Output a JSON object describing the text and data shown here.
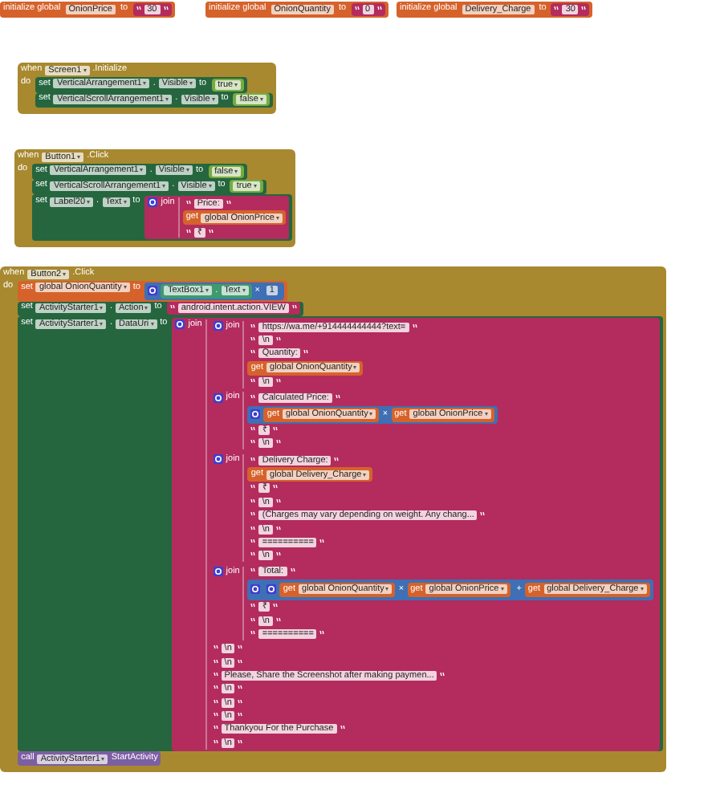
{
  "workspace": {
    "blocks": [
      {
        "kind": "init",
        "label": "initialize global",
        "name": "OnionPrice",
        "to": "to",
        "value": {
          "kind": "text",
          "value": "30"
        }
      },
      {
        "kind": "init",
        "label": "initialize global",
        "name": "OnionQuantity",
        "to": "to",
        "value": {
          "kind": "text",
          "value": "0"
        }
      },
      {
        "kind": "init",
        "label": "initialize global",
        "name": "Delivery_Charge",
        "to": "to",
        "value": {
          "kind": "text",
          "value": "30"
        }
      },
      {
        "kind": "event",
        "when": "when",
        "component": "Screen1",
        "event": ".Initialize",
        "do": "do",
        "statements": [
          {
            "kind": "set",
            "set": "set",
            "component": "VerticalArrangement1",
            "dot": ".",
            "property": "Visible",
            "to": "to",
            "value": {
              "kind": "logic",
              "value": "true"
            }
          },
          {
            "kind": "set",
            "set": "set",
            "component": "VerticalScrollArrangement1",
            "dot": ".",
            "property": "Visible",
            "to": "to",
            "value": {
              "kind": "logic",
              "value": "false"
            }
          }
        ]
      },
      {
        "kind": "event",
        "when": "when",
        "component": "Button1",
        "event": ".Click",
        "do": "do",
        "statements": [
          {
            "kind": "set",
            "set": "set",
            "component": "VerticalArrangement1",
            "dot": ".",
            "property": "Visible",
            "to": "to",
            "value": {
              "kind": "logic",
              "value": "false"
            }
          },
          {
            "kind": "set",
            "set": "set",
            "component": "VerticalScrollArrangement1",
            "dot": ".",
            "property": "Visible",
            "to": "to",
            "value": {
              "kind": "logic",
              "value": "true"
            }
          },
          {
            "kind": "set",
            "set": "set",
            "component": "Label20",
            "dot": ".",
            "property": "Text",
            "to": "to",
            "value": {
              "kind": "join",
              "label": "join",
              "items": [
                {
                  "kind": "text",
                  "value": "Price: "
                },
                {
                  "kind": "get",
                  "get": "get",
                  "variable": "global OnionPrice"
                },
                {
                  "kind": "text",
                  "value": "₹"
                }
              ]
            }
          }
        ]
      },
      {
        "kind": "event",
        "when": "when",
        "component": "Button2",
        "event": ".Click",
        "do": "do",
        "statements": [
          {
            "kind": "set_global",
            "set": "set",
            "variable": "global OnionQuantity",
            "to": "to",
            "value": {
              "kind": "math",
              "op": "×",
              "left": {
                "kind": "component_get",
                "component": "TextBox1",
                "dot": ".",
                "property": "Text"
              },
              "right": {
                "kind": "number",
                "value": "1"
              }
            }
          },
          {
            "kind": "set",
            "set": "set",
            "component": "ActivityStarter1",
            "dot": ".",
            "property": "Action",
            "to": "to",
            "value": {
              "kind": "text",
              "value": "android.intent.action.VIEW"
            }
          },
          {
            "kind": "set",
            "set": "set",
            "component": "ActivityStarter1",
            "dot": ".",
            "property": "DataUri",
            "to": "to",
            "value": {
              "kind": "join",
              "label": "join",
              "items": [
                {
                  "kind": "join",
                  "label": "join",
                  "items": [
                    {
                      "kind": "text",
                      "value": "https://wa.me/+914444444444?text="
                    },
                    {
                      "kind": "text",
                      "value": "\\n"
                    },
                    {
                      "kind": "text",
                      "value": "Quantity: "
                    },
                    {
                      "kind": "get",
                      "get": "get",
                      "variable": "global OnionQuantity"
                    },
                    {
                      "kind": "text",
                      "value": "\\n"
                    }
                  ]
                },
                {
                  "kind": "join",
                  "label": "join",
                  "items": [
                    {
                      "kind": "text",
                      "value": "Calculated Price: "
                    },
                    {
                      "kind": "math",
                      "op": "×",
                      "left": {
                        "kind": "get",
                        "get": "get",
                        "variable": "global OnionQuantity"
                      },
                      "right": {
                        "kind": "get",
                        "get": "get",
                        "variable": "global OnionPrice"
                      }
                    },
                    {
                      "kind": "text",
                      "value": "₹"
                    },
                    {
                      "kind": "text",
                      "value": "\\n"
                    }
                  ]
                },
                {
                  "kind": "join",
                  "label": "join",
                  "items": [
                    {
                      "kind": "text",
                      "value": "Delivery Charge: "
                    },
                    {
                      "kind": "get",
                      "get": "get",
                      "variable": "global Delivery_Charge"
                    },
                    {
                      "kind": "text",
                      "value": "₹"
                    },
                    {
                      "kind": "text",
                      "value": "\\n"
                    },
                    {
                      "kind": "text",
                      "value": "(Charges may vary depending on weight. Any chang..."
                    },
                    {
                      "kind": "text",
                      "value": "\\n"
                    },
                    {
                      "kind": "text",
                      "value": "=========="
                    },
                    {
                      "kind": "text",
                      "value": "\\n"
                    }
                  ]
                },
                {
                  "kind": "join",
                  "label": "join",
                  "items": [
                    {
                      "kind": "text",
                      "value": "Total: "
                    },
                    {
                      "kind": "math",
                      "op": "+",
                      "left": {
                        "kind": "math",
                        "op": "×",
                        "left": {
                          "kind": "get",
                          "get": "get",
                          "variable": "global OnionQuantity"
                        },
                        "right": {
                          "kind": "get",
                          "get": "get",
                          "variable": "global OnionPrice"
                        }
                      },
                      "right": {
                        "kind": "get",
                        "get": "get",
                        "variable": "global Delivery_Charge"
                      }
                    },
                    {
                      "kind": "text",
                      "value": "₹"
                    },
                    {
                      "kind": "text",
                      "value": "\\n"
                    },
                    {
                      "kind": "text",
                      "value": "=========="
                    }
                  ]
                },
                {
                  "kind": "text",
                  "value": "\\n"
                },
                {
                  "kind": "text",
                  "value": "\\n"
                },
                {
                  "kind": "text",
                  "value": "Please, Share the Screenshot after making paymen..."
                },
                {
                  "kind": "text",
                  "value": "\\n"
                },
                {
                  "kind": "text",
                  "value": "\\n"
                },
                {
                  "kind": "text",
                  "value": "\\n"
                },
                {
                  "kind": "text",
                  "value": "Thankyou For the Purchase"
                },
                {
                  "kind": "text",
                  "value": "\\n"
                }
              ]
            }
          },
          {
            "kind": "call",
            "call": "call",
            "component": "ActivityStarter1",
            "method": "StartActivity"
          }
        ]
      }
    ]
  }
}
